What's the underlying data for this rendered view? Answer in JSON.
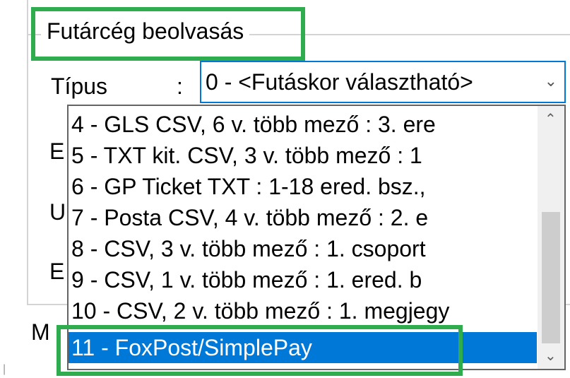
{
  "group": {
    "title": "Futárcég beolvasás"
  },
  "tipus": {
    "label": "Típus",
    "colon": ":",
    "value": "0 - <Futáskor választható>"
  },
  "hidden_labels": [
    "E",
    "U",
    "E",
    "M"
  ],
  "dropdown": {
    "options": [
      "4 - GLS CSV, 6 v. több mező : 3. ere",
      "5 - TXT kit. CSV, 3 v. több mező : 1",
      "6 - GP Ticket TXT : 1-18 ered. bsz.,",
      "7 - Posta CSV, 4 v. több mező : 2. e",
      "8 - CSV, 3 v. több mező : 1. csoport",
      "9 - CSV, 1 v. több mező : 1. ered. b",
      "10 - CSV, 2 v. több mező : 1. megjegy",
      "11 - FoxPost/SimplePay"
    ],
    "selected_index": 7
  },
  "colors": {
    "highlight": "#2fad4e",
    "selection": "#0078d7",
    "focus_border": "#0078d7"
  },
  "icons": {
    "combo_arrow": "chevron-down-icon",
    "scroll_up": "chevron-up-icon",
    "scroll_down": "chevron-down-icon"
  }
}
